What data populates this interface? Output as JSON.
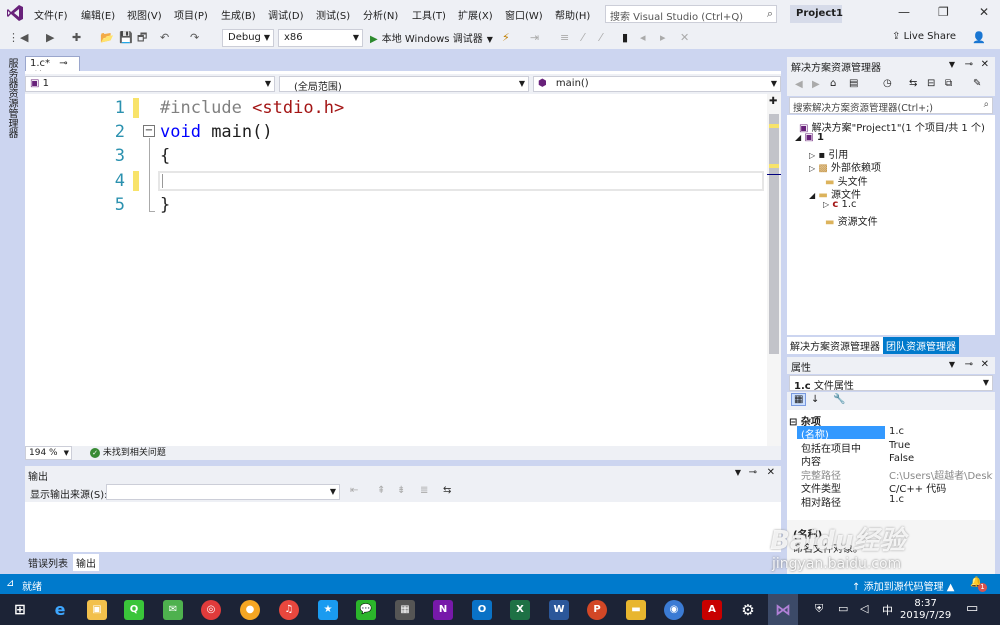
{
  "menubar": {
    "items": [
      "文件(F)",
      "编辑(E)",
      "视图(V)",
      "项目(P)",
      "生成(B)",
      "调试(D)",
      "测试(S)",
      "分析(N)",
      "工具(T)",
      "扩展(X)",
      "窗口(W)",
      "帮助(H)"
    ],
    "search_placeholder": "搜索 Visual Studio (Ctrl+Q)",
    "project_title": "Project1"
  },
  "toolbar": {
    "config": "Debug",
    "platform": "x86",
    "start_debug": "本地 Windows 调试器",
    "live_share": "Live Share"
  },
  "left_strip": {
    "server_explorer": "服务器资源管理器"
  },
  "editor": {
    "tab_label": "1.c*",
    "nav_project": "1",
    "nav_scope": "(全局范围)",
    "nav_member": "main()",
    "line_numbers": [
      "1",
      "2",
      "3",
      "4",
      "5"
    ],
    "lines": {
      "l1_directive": "#include",
      "l1_header": "<stdio.h>",
      "l2_keyword": "void",
      "l2_rest": " main()",
      "l3": "{",
      "l5": "}"
    },
    "zoom": "194 %",
    "issues": "未找到相关问题"
  },
  "output": {
    "title": "输出",
    "source_label": "显示输出来源(S):",
    "tabs": [
      "错误列表",
      "输出"
    ]
  },
  "solution_explorer": {
    "title": "解决方案资源管理器",
    "search_placeholder": "搜索解决方案资源管理器(Ctrl+;)",
    "solution_node": "解决方案\"Project1\"(1 个项目/共 1 个)",
    "project_node": "1",
    "nodes": [
      "引用",
      "外部依赖项",
      "头文件",
      "源文件",
      "1.c",
      "资源文件"
    ],
    "tabs": [
      "解决方案资源管理器",
      "团队资源管理器"
    ]
  },
  "properties": {
    "title": "属性",
    "selected": "1.c",
    "selected_type": "文件属性",
    "category": "杂项",
    "rows": [
      {
        "key": "(名称)",
        "value": "1.c"
      },
      {
        "key": "包括在项目中",
        "value": "True"
      },
      {
        "key": "内容",
        "value": "False"
      },
      {
        "key": "完整路径",
        "value": "C:\\Users\\超越者\\Desktop"
      },
      {
        "key": "文件类型",
        "value": "C/C++ 代码"
      },
      {
        "key": "相对路径",
        "value": "1.c"
      }
    ],
    "desc_title": "(名称)",
    "desc_text": "命名文件对象。"
  },
  "statusbar": {
    "ready": "就绪",
    "add_source": "添加到源代码管理",
    "notif_count": "1"
  },
  "taskbar": {
    "ime": "中",
    "time": "8:37",
    "date": "2019/7/29"
  },
  "watermark": {
    "brand": "Baidu经验",
    "url": "jingyan.baidu.com"
  },
  "colors": {
    "accent": "#007acc",
    "vs_purple": "#68217a",
    "line_number": "#2b91af",
    "keyword": "#0000ff",
    "string": "#a31515",
    "directive": "#808080"
  }
}
